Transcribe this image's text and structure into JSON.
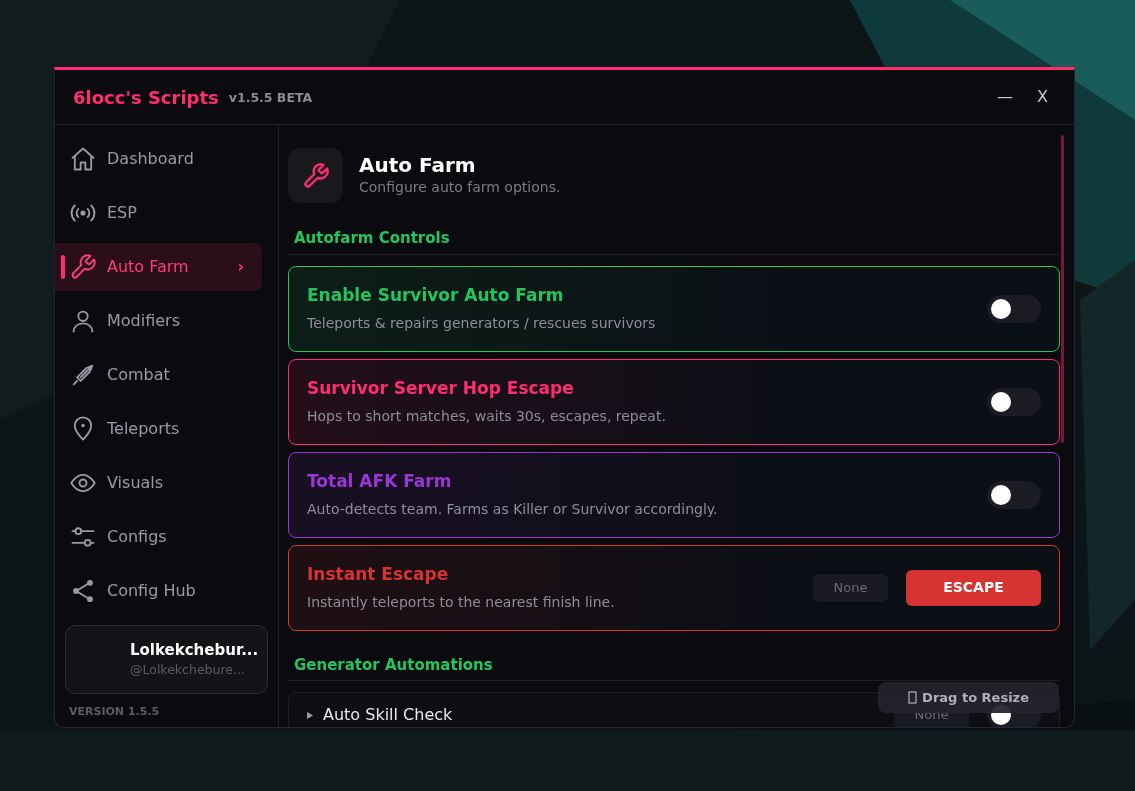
{
  "window": {
    "title": "6locc's Scripts",
    "version": "v1.5.5 BETA",
    "controls": [
      "—",
      "X"
    ]
  },
  "sidebar": {
    "items": [
      {
        "label": "Dashboard",
        "selected": false
      },
      {
        "label": "ESP",
        "selected": false
      },
      {
        "label": "Auto Farm",
        "selected": true,
        "chevron": "›"
      },
      {
        "label": "Modifiers",
        "selected": false
      },
      {
        "label": "Combat",
        "selected": false
      },
      {
        "label": "Teleports",
        "selected": false
      },
      {
        "label": "Visuals",
        "selected": false
      },
      {
        "label": "Configs",
        "selected": false
      },
      {
        "label": "Config Hub",
        "selected": false
      }
    ],
    "user": {
      "name": "Lolkekchebur...",
      "handle": "@Lolkekchebure..."
    },
    "version": "VERSION 1.5.5"
  },
  "page": {
    "title": "Auto Farm",
    "subtitle": "Configure auto farm options."
  },
  "sections": [
    {
      "title": "Autofarm Controls",
      "items": [
        {
          "kind": "toggle",
          "title": "Enable Survivor Auto Farm",
          "description": "Teleports & repairs generators / rescues survivors",
          "color": "#22c55e",
          "on": false
        },
        {
          "kind": "toggle",
          "title": "Survivor Server Hop Escape",
          "description": "Hops to short matches, waits 30s, escapes, repeat.",
          "color": "#ff2d6f",
          "on": false
        },
        {
          "kind": "toggle",
          "title": "Total AFK Farm",
          "description": "Auto-detects team. Farms as Killer or Survivor accordingly.",
          "color": "#9b35d6",
          "on": false
        },
        {
          "kind": "action",
          "title": "Instant Escape",
          "description": "Instantly teleports to the nearest finish line.",
          "color": "#d63333",
          "keybind": "None",
          "button": "ESCAPE"
        }
      ]
    },
    {
      "title": "Generator Automations",
      "items": [
        {
          "kind": "collapsible",
          "title": "Auto Skill Check",
          "keybind": "None",
          "on": false
        }
      ]
    }
  ],
  "resize_hint": "Drag to Resize"
}
